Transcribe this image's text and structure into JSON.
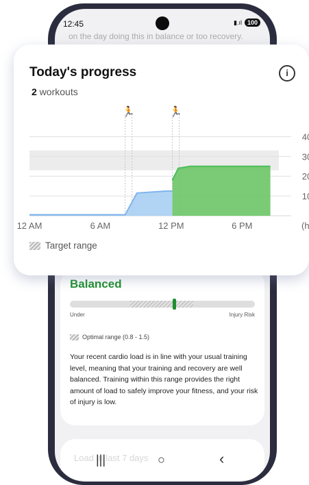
{
  "status": {
    "time": "12:45",
    "battery": "100"
  },
  "background": {
    "faded_text": "on the day doing this in balance or too recovery.",
    "balanced_label": "Balanced",
    "bar_left_label": "Under",
    "bar_right_label": "Injury Risk",
    "optimal_label": "Optimal range (0.8 - 1.5)",
    "description": "Your recent cardio load is in line with your usual training level, meaning that your training and recovery are well balanced. Training within this range provides the right amount of load to safely improve your fitness, and your risk of injury is low.",
    "faded_bottom": "Load in last 7 days"
  },
  "card": {
    "title": "Today's progress",
    "workout_count": "2",
    "workout_label": " workouts",
    "info_glyph": "i",
    "legend_label": "Target range"
  },
  "nav": {
    "recents": "|||",
    "home": "○",
    "back": "‹"
  },
  "chart_data": {
    "type": "area",
    "x_unit": "(h)",
    "x_ticks": [
      "12 AM",
      "6 AM",
      "12 PM",
      "6 PM"
    ],
    "y_ticks": [
      10,
      20,
      30,
      40
    ],
    "ylim": [
      0,
      45
    ],
    "xlim": [
      0,
      21
    ],
    "target_range": [
      23,
      33
    ],
    "workouts_at": [
      8.1,
      12.1
    ],
    "series": [
      {
        "x": [
          0,
          8.1,
          9.1,
          11.6,
          12.1
        ],
        "y": [
          0.5,
          0.5,
          11.5,
          12.5,
          12.5
        ],
        "color": "#7fb3ec"
      },
      {
        "x": [
          12.1,
          12.6,
          13.6,
          20.4
        ],
        "y": [
          18,
          24,
          25,
          25
        ],
        "color": "#4dbd59"
      }
    ]
  },
  "colors": {
    "accent_green": "#1e8f2e",
    "blue_fill": "#a9cff3",
    "green_fill": "#6dc567"
  }
}
